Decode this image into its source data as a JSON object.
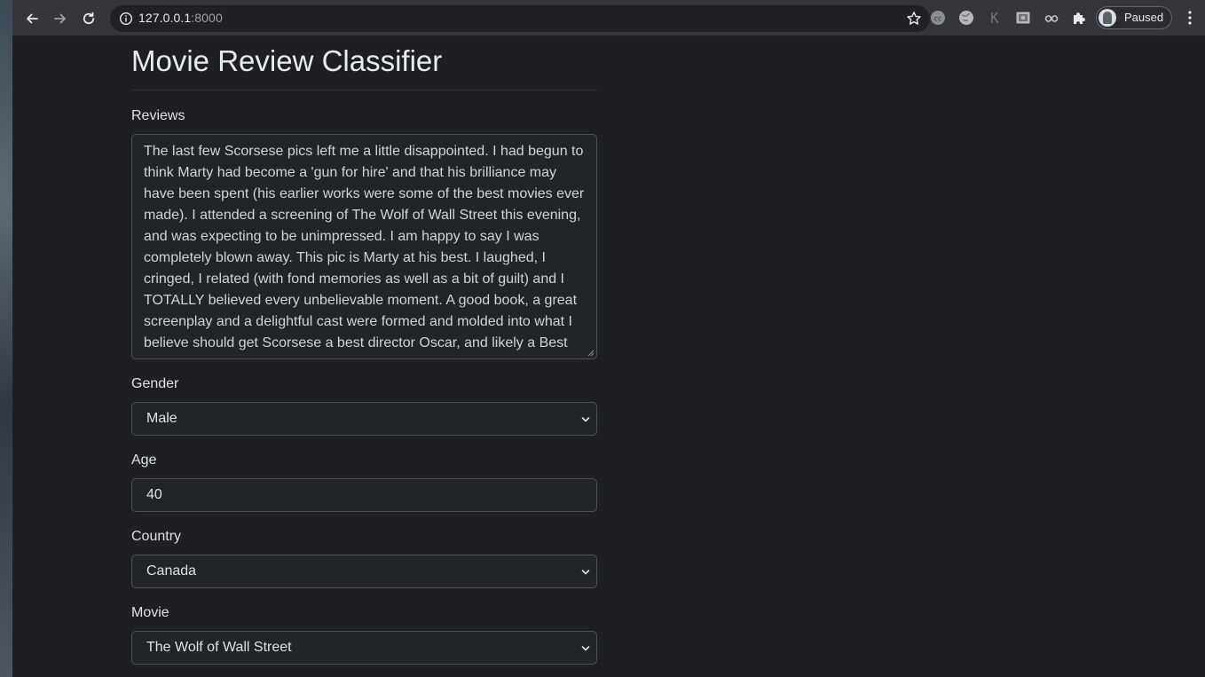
{
  "browser": {
    "url_host": "127.0.0.1",
    "url_port": ":8000",
    "profile_label": "Paused"
  },
  "page": {
    "title": "Movie Review Classifier",
    "reviews": {
      "label": "Reviews",
      "text": "The last few Scorsese pics left me a little disappointed. I had begun to think Marty had become a 'gun for hire' and that his brilliance may have been spent (his earlier works were some of the best movies ever made). I attended a screening of The Wolf of Wall Street this evening, and was expecting to be unimpressed. I am happy to say I was completely blown away. This pic is Marty at his best. I laughed, I cringed, I related (with fond memories as well as a bit of guilt) and I TOTALLY believed every unbelievable moment. A good book, a great screenplay and a delightful cast were formed and molded into what I believe should get Scorsese a best director Oscar, and likely a Best"
    },
    "gender": {
      "label": "Gender",
      "value": "Male"
    },
    "age": {
      "label": "Age",
      "value": "40"
    },
    "country": {
      "label": "Country",
      "value": "Canada"
    },
    "movie": {
      "label": "Movie",
      "value": "The Wolf of Wall Street"
    }
  }
}
